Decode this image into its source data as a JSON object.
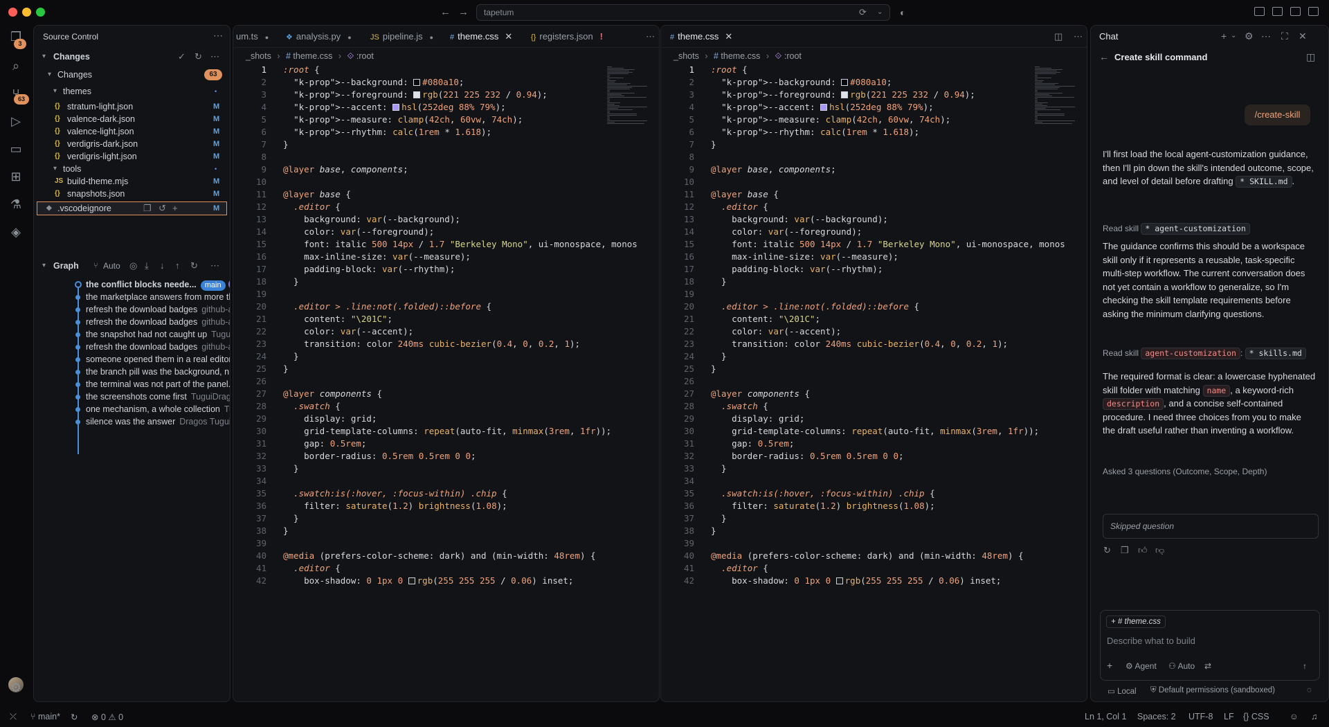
{
  "titlebar": {
    "search_text": "tapetum"
  },
  "activity": {
    "scm_badge": "3",
    "git_badge": "63"
  },
  "sidebar": {
    "title": "Source Control",
    "changes_header": "Changes",
    "changes_group": "Changes",
    "changes_count": "63",
    "files": [
      {
        "kind": "folder",
        "name": "themes",
        "flag": "•"
      },
      {
        "kind": "json",
        "name": "stratum-light.json",
        "flag": "M"
      },
      {
        "kind": "json",
        "name": "valence-dark.json",
        "flag": "M"
      },
      {
        "kind": "json",
        "name": "valence-light.json",
        "flag": "M"
      },
      {
        "kind": "json",
        "name": "verdigris-dark.json",
        "flag": "M"
      },
      {
        "kind": "json",
        "name": "verdigris-light.json",
        "flag": "M"
      },
      {
        "kind": "folder",
        "name": "tools",
        "flag": "•"
      },
      {
        "kind": "js",
        "name": "build-theme.mjs",
        "flag": "M"
      },
      {
        "kind": "json",
        "name": "snapshots.json",
        "flag": "M"
      },
      {
        "kind": "ignore",
        "name": ".vscodeignore",
        "flag": "M"
      }
    ],
    "graph_header": "Graph",
    "graph_auto": "Auto",
    "branch_pill": "main",
    "commits": [
      {
        "msg": "the conflict blocks neede...",
        "author": ""
      },
      {
        "msg": "the marketplace answers from more th...",
        "author": ""
      },
      {
        "msg": "refresh the download badges",
        "author": "github-a..."
      },
      {
        "msg": "refresh the download badges",
        "author": "github-a..."
      },
      {
        "msg": "the snapshot had not caught up",
        "author": "Tugui ..."
      },
      {
        "msg": "refresh the download badges",
        "author": "github-a..."
      },
      {
        "msg": "someone opened them in a real editor...",
        "author": ""
      },
      {
        "msg": "the branch pill was the background, n...",
        "author": ""
      },
      {
        "msg": "the terminal was not part of the panel...",
        "author": ""
      },
      {
        "msg": "the screenshots come first",
        "author": "TuguiDragos"
      },
      {
        "msg": "one mechanism, a whole collection",
        "author": "Tu..."
      },
      {
        "msg": "silence was the answer",
        "author": "Dragos Tugui"
      }
    ]
  },
  "editor_left": {
    "tabs": [
      {
        "label": "um.ts",
        "icon": "",
        "state": "dot"
      },
      {
        "label": "analysis.py",
        "icon": "❖",
        "state": "dot"
      },
      {
        "label": "pipeline.js",
        "icon": "JS",
        "state": "dot"
      },
      {
        "label": "theme.css",
        "icon": "#",
        "state": "close"
      },
      {
        "label": "registers.json",
        "icon": "{}",
        "state": "warn"
      }
    ],
    "crumbs": [
      "_shots",
      "theme.css",
      ":root"
    ]
  },
  "editor_right": {
    "tabs": [
      {
        "label": "theme.css",
        "icon": "#",
        "state": "close"
      }
    ],
    "crumbs": [
      "_shots",
      "theme.css",
      ":root"
    ]
  },
  "code_lines": [
    ":root {",
    "  --background: #080a10;",
    "  --foreground: rgb(221 225 232 / 0.94);",
    "  --accent: hsl(252deg 88% 79%);",
    "  --measure: clamp(42ch, 60vw, 74ch);",
    "  --rhythm: calc(1rem * 1.618);",
    "}",
    "",
    "@layer base, components;",
    "",
    "@layer base {",
    "  .editor {",
    "    background: var(--background);",
    "    color: var(--foreground);",
    "    font: italic 500 14px / 1.7 \"Berkeley Mono\", ui-monospace, monos",
    "    max-inline-size: var(--measure);",
    "    padding-block: var(--rhythm);",
    "  }",
    "",
    "  .editor > .line:not(.folded)::before {",
    "    content: \"\\201C\";",
    "    color: var(--accent);",
    "    transition: color 240ms cubic-bezier(0.4, 0, 0.2, 1);",
    "  }",
    "}",
    "",
    "@layer components {",
    "  .swatch {",
    "    display: grid;",
    "    grid-template-columns: repeat(auto-fit, minmax(3rem, 1fr));",
    "    gap: 0.5rem;",
    "    border-radius: 0.5rem 0.5rem 0 0;",
    "  }",
    "",
    "  .swatch:is(:hover, :focus-within) .chip {",
    "    filter: saturate(1.2) brightness(1.08);",
    "  }",
    "}",
    "",
    "@media (prefers-color-scheme: dark) and (min-width: 48rem) {",
    "  .editor {",
    "    box-shadow: 0 1px 0 rgb(255 255 255 / 0.06) inset;"
  ],
  "chat": {
    "title": "Chat",
    "subtitle": "Create skill command",
    "user_message": "/create-skill",
    "p1_a": "I'll first load the local agent-customization guidance, then I'll pin down the skill's intended outcome, scope, and level of detail before drafting",
    "p1_chip": "SKILL.md",
    "p1_end": ".",
    "read1_label": "Read skill",
    "read1_chip": "agent-customization",
    "p2": "The guidance confirms this should be a workspace skill only if it represents a reusable, task-specific multi-step workflow. The current conversation does not yet contain a workflow to generalize, so I'm checking the skill template requirements before asking the minimum clarifying questions.",
    "read2_label": "Read skill",
    "read2_chip_a": "agent-customization",
    "read2_sep": ":",
    "read2_chip_b": "skills.md",
    "p3_a": "The required format is clear: a lowercase hyphenated skill folder with matching",
    "p3_chip1": "name",
    "p3_b": ", a keyword-rich",
    "p3_chip2": "description",
    "p3_c": ", and a concise self-contained procedure. I need three choices from you to make the draft useful rather than inventing a workflow.",
    "asked": "Asked 3 questions (Outcome, Scope, Depth)",
    "skipped": "Skipped question",
    "context_chip": "theme.css",
    "input_placeholder": "Describe what to build",
    "agent_label": "Agent",
    "auto_label": "Auto",
    "local_label": "Local",
    "permissions_label": "Default permissions (sandboxed)"
  },
  "status": {
    "branch": "main*",
    "errors": "0",
    "warnings": "0",
    "position": "Ln 1, Col 1",
    "spaces": "Spaces: 2",
    "encoding": "UTF-8",
    "eol": "LF",
    "language": "CSS"
  },
  "colors": {
    "accent_orange": "#f0a37b",
    "badge": "#e0915c",
    "modified": "#5aa3e8",
    "graph_line": "#4a8fdc"
  }
}
